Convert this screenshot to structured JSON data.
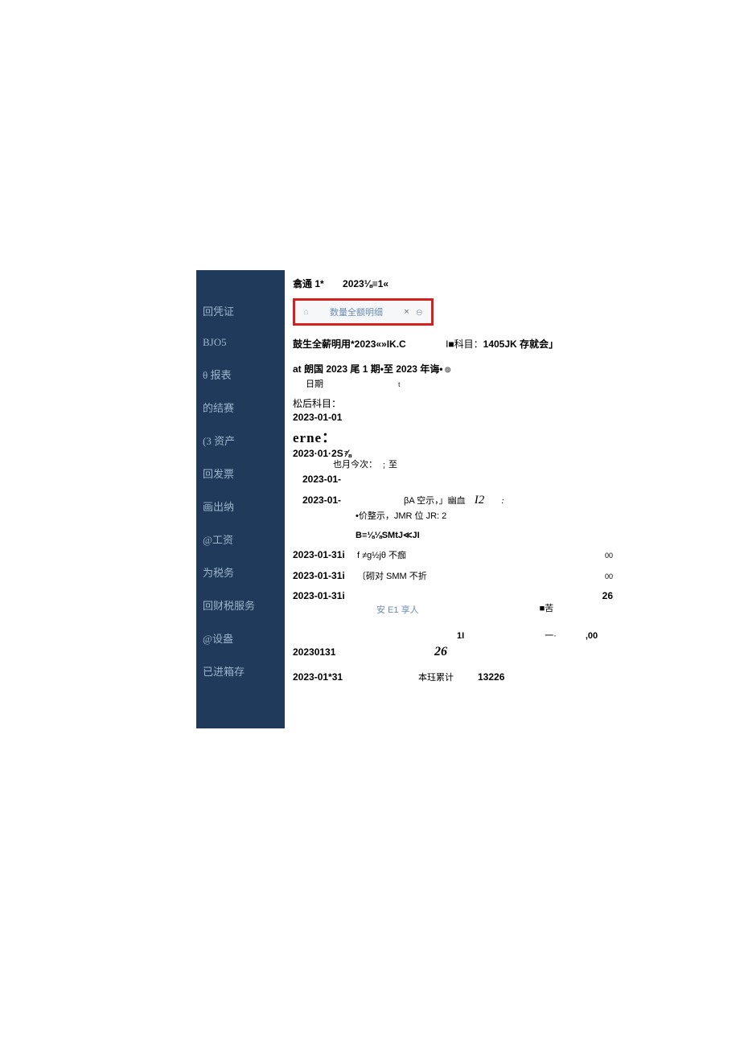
{
  "sidebar": {
    "items": [
      {
        "label": "回凭证"
      },
      {
        "label": "BJO5"
      },
      {
        "label": "θ 报表"
      },
      {
        "label": "的结赛"
      },
      {
        "label": "(3 资产"
      },
      {
        "label": "回发票"
      },
      {
        "label": "画出纳"
      },
      {
        "label": "@工资"
      },
      {
        "label": "为税务"
      },
      {
        "label": "回财税服务"
      },
      {
        "label": "@设盎"
      },
      {
        "label": "已进箱存"
      }
    ]
  },
  "top": {
    "org": "翕通 1*",
    "period": "2023⅛≡1«"
  },
  "tab": {
    "home_icon": "⌂",
    "label": "数量全额明细",
    "close": "×",
    "refresh": "⊖"
  },
  "subtitle": {
    "left": "鼓生全薪明用*2023«»IK.C",
    "kmu_label": "I■科目：",
    "kmu_val": "1405JK 存就会」"
  },
  "period_line": "at 朗国 2023 尾 1 期•至 2023 年诲•",
  "period_date": "日期",
  "refresh_icon": "⊚",
  "t_sub": "t",
  "songhou": "松后科目：",
  "date1": "2023-01-01",
  "erne": "erne：",
  "line25": "2023·01·2S⅞",
  "yue": "也月今次：    ﹔至",
  "date_a": "2023-01-",
  "date_b": "2023-01-",
  "ba": {
    "line1a": "βA 空示，」幽血",
    "i2": "I2",
    "colon": ":",
    "line2": "•价整示，JMR 位 JR:  2",
    "line3": "B≡⅛⅛SMtJ≪JI"
  },
  "rows": [
    {
      "d": "2023-01-31i",
      "mid": "f  ≠g½jθ 不痂",
      "r": "00"
    },
    {
      "d": "2023-01-31i",
      "mid": "〔砌对 SMM 不折",
      "r": "00"
    },
    {
      "d": "2023-01-31i",
      "mid": "",
      "r": "26"
    }
  ],
  "priv": "安 E1 享人",
  "ku": "■苦",
  "row_last": {
    "n1": "1I",
    "dash": "一·",
    "amt": ",00"
  },
  "row_131": {
    "d": "20230131",
    "i26": "26"
  },
  "row_final": {
    "d": "2023-01*31",
    "lbl": "本珏累计",
    "amt": "13226"
  }
}
